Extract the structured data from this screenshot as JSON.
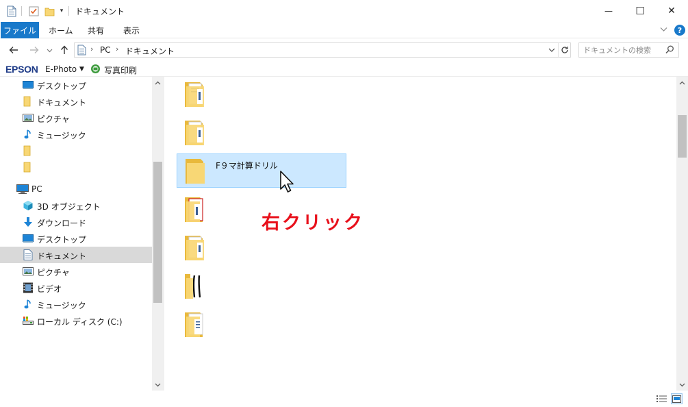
{
  "window": {
    "title": "ドキュメント",
    "minimize_glyph": "—",
    "maximize_glyph": "☐",
    "close_glyph": "✕"
  },
  "ribbon": {
    "tabs": [
      {
        "label": "ファイル"
      },
      {
        "label": "ホーム"
      },
      {
        "label": "共有"
      },
      {
        "label": "表示"
      }
    ],
    "help_label": "?"
  },
  "address_bar": {
    "crumbs": [
      "PC",
      "ドキュメント"
    ],
    "search_placeholder": "ドキュメントの検索"
  },
  "epson_bar": {
    "brand": "EPSON",
    "app": "E-Photo",
    "print_label": "写真印刷"
  },
  "nav_pane": {
    "items": [
      {
        "label": "デスクトップ",
        "icon": "desktop-icon"
      },
      {
        "label": "ドキュメント",
        "icon": "folder-icon"
      },
      {
        "label": "ピクチャ",
        "icon": "pictures-icon"
      },
      {
        "label": "ミュージック",
        "icon": "music-icon"
      },
      {
        "label": "",
        "icon": "folder-icon"
      },
      {
        "label": "",
        "icon": "folder-icon"
      },
      {
        "label": "PC",
        "icon": "pc-icon"
      },
      {
        "label": "3D オブジェクト",
        "icon": "3d-objects-icon"
      },
      {
        "label": "ダウンロード",
        "icon": "download-icon"
      },
      {
        "label": "デスクトップ",
        "icon": "desktop-icon"
      },
      {
        "label": "ドキュメント",
        "icon": "documents-icon",
        "selected": true
      },
      {
        "label": "ピクチャ",
        "icon": "pictures-icon"
      },
      {
        "label": "ビデオ",
        "icon": "video-icon"
      },
      {
        "label": "ミュージック",
        "icon": "music-icon"
      },
      {
        "label": "ローカル ディスク (C:)",
        "icon": "local-disk-icon"
      }
    ]
  },
  "content": {
    "files": [
      {
        "name": "",
        "icon": "folder-with-documents-icon"
      },
      {
        "name": "",
        "icon": "folder-with-documents-icon"
      },
      {
        "name": "F９マ計算ドリル",
        "icon": "folder-icon",
        "selected": true
      },
      {
        "name": "",
        "icon": "folder-with-red-document-icon"
      },
      {
        "name": "",
        "icon": "folder-with-documents-icon"
      },
      {
        "name": "",
        "icon": "folder-with-black-document-icon"
      },
      {
        "name": "",
        "icon": "folder-with-documents-icon"
      }
    ],
    "annotation": "右クリック"
  },
  "colors": {
    "accent": "#1979ca",
    "selection": "#cce8ff",
    "annotation": "#e8101b",
    "folder": "#f8d775"
  }
}
